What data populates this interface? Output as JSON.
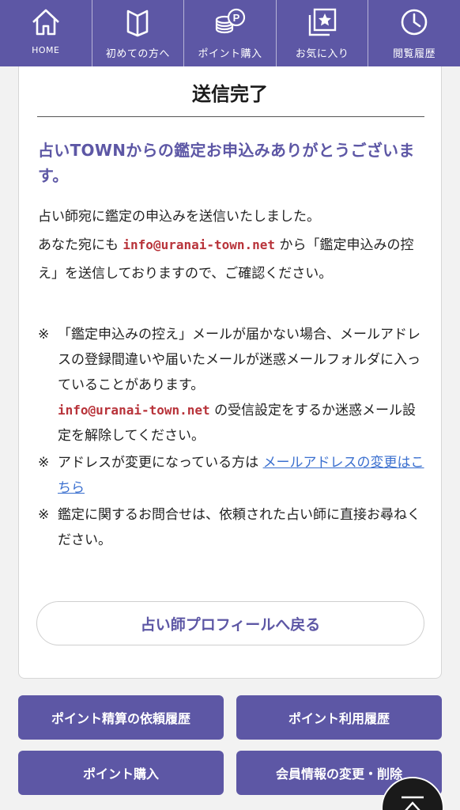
{
  "nav": {
    "items": [
      {
        "label": "HOME",
        "icon": "home-icon"
      },
      {
        "label": "初めての方へ",
        "icon": "book-icon"
      },
      {
        "label": "ポイント購入",
        "icon": "coins-icon"
      },
      {
        "label": "お気に入り",
        "icon": "star-icon"
      },
      {
        "label": "閲覧履歴",
        "icon": "clock-icon"
      }
    ]
  },
  "card": {
    "title": "送信完了",
    "thanks": "占いTOWNからの鑑定お申込みありがとうございます。",
    "para_line1": "占い師宛に鑑定の申込みを送信いたしました。",
    "para_line2_prefix": "あなた宛にも",
    "email": "info@uranai-town.net",
    "para_line2_suffix": "から「鑑定申込みの控え」を送信しておりますので、ご確認ください。",
    "note_mark": "※",
    "note1_text": "「鑑定申込みの控え」メールが届かない場合、メールアドレスの登録間違いや届いたメールが迷惑メールフォルダに入っていることがあります。",
    "note1_suffix": "の受信設定をするか迷惑メール設定を解除してください。",
    "note2_text": "アドレスが変更になっている方は",
    "note2_link": "メールアドレスの変更はこちら",
    "note3_text": "鑑定に関するお問合せは、依頼された占い師に直接お尋ねください。",
    "back_button": "占い師プロフィールへ戻る"
  },
  "buttons": {
    "point_settlement_history": "ポイント精算の依頼履歴",
    "point_usage_history": "ポイント利用履歴",
    "point_purchase": "ポイント購入",
    "member_info": "会員情報の変更・削除"
  },
  "colors": {
    "brand": "#5d57a5",
    "email_red": "#b8333a",
    "link_blue": "#3a6fcf"
  }
}
